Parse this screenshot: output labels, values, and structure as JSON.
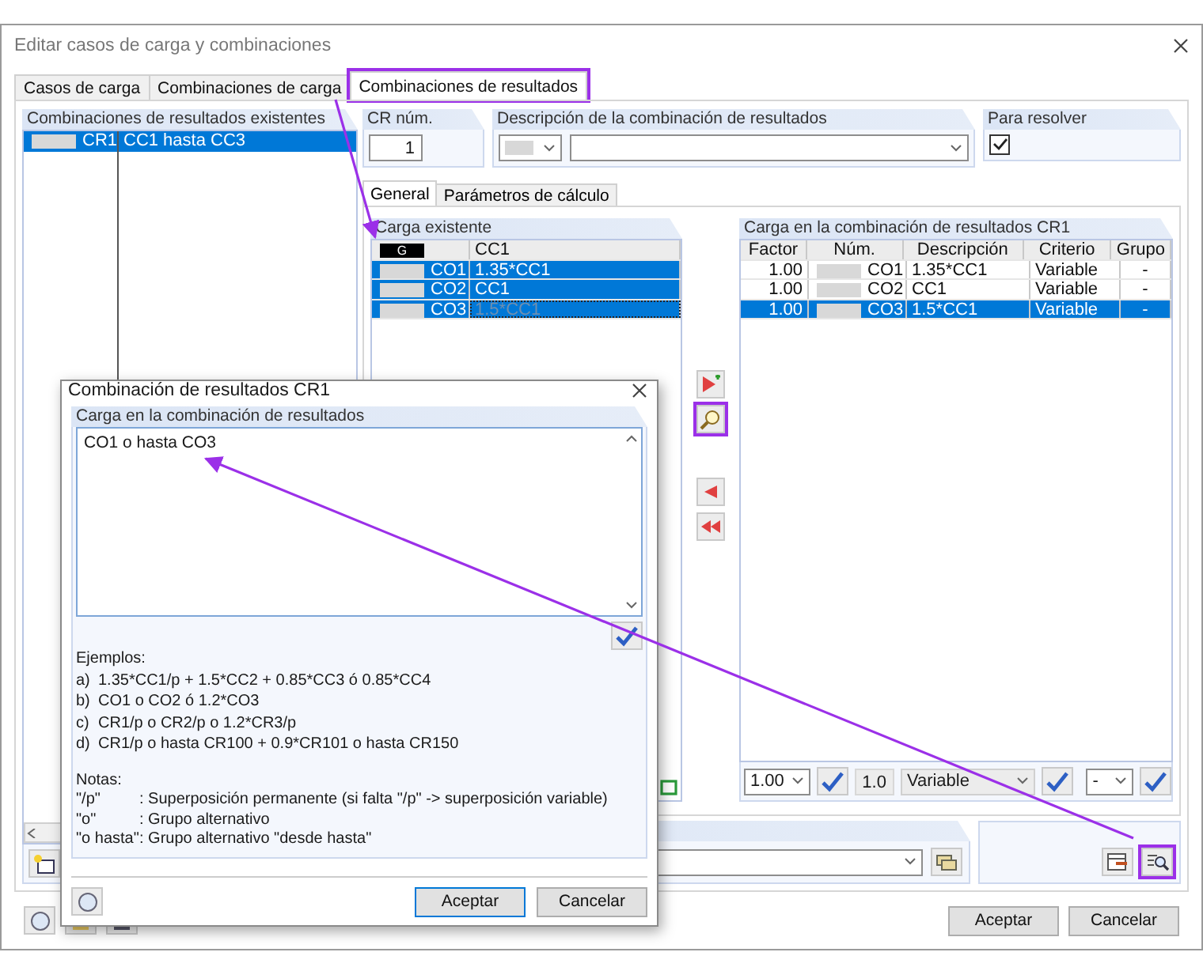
{
  "window": {
    "title": "Editar casos de carga y combinaciones"
  },
  "tabs": [
    {
      "label": "Casos de carga",
      "selected": false,
      "highlighted": false
    },
    {
      "label": "Combinaciones de carga",
      "selected": false,
      "highlighted": false
    },
    {
      "label": "Combinaciones de resultados",
      "selected": true,
      "highlighted": true
    }
  ],
  "existing": {
    "title": "Combinaciones de resultados existentes",
    "rows": [
      {
        "number": "CR1",
        "description": "CC1 hasta CC3",
        "selected": true
      }
    ]
  },
  "cr_number": {
    "label": "CR núm.",
    "value": "1"
  },
  "description": {
    "label": "Descripción de la combinación de resultados"
  },
  "to_solve": {
    "label": "Para resolver",
    "checked": true
  },
  "subtabs": [
    {
      "label": "General",
      "selected": true
    },
    {
      "label": "Parámetros de cálculo",
      "selected": false
    }
  ],
  "existing_loads": {
    "title": "Carga existente",
    "group": {
      "badge": "G",
      "label": "CC1"
    },
    "rows": [
      {
        "number": "CO1",
        "description": "1.35*CC1",
        "selected": true,
        "dimmed": false
      },
      {
        "number": "CO2",
        "description": "CC1",
        "selected": true,
        "dimmed": false
      },
      {
        "number": "CO3",
        "description": "1.5*CC1",
        "selected": true,
        "dimmed": true
      }
    ]
  },
  "transfer_buttons": [
    {
      "kind": "add",
      "highlighted": false
    },
    {
      "kind": "edit",
      "highlighted": true
    },
    {
      "kind": "remove",
      "highlighted": false
    },
    {
      "kind": "remove_all",
      "highlighted": false
    }
  ],
  "combination": {
    "title": "Carga en la combinación de resultados CR1",
    "columns": [
      "Factor",
      "Núm.",
      "Descripción",
      "Criterio",
      "Grupo"
    ],
    "rows": [
      {
        "factor": "1.00",
        "number": "CO1",
        "description": "1.35*CC1",
        "criterion": "Variable",
        "group": "-",
        "selected": false
      },
      {
        "factor": "1.00",
        "number": "CO2",
        "description": "CC1",
        "criterion": "Variable",
        "group": "-",
        "selected": false
      },
      {
        "factor": "1.00",
        "number": "CO3",
        "description": "1.5*CC1",
        "criterion": "Variable",
        "group": "-",
        "selected": true
      }
    ],
    "factor": "1.00",
    "criterion_factor": "1.0",
    "criterion": "Variable",
    "group": "-"
  },
  "tools": [
    {
      "kind": "export",
      "highlighted": false
    },
    {
      "kind": "zoom",
      "highlighted": true
    }
  ],
  "buttons": [
    "Aceptar",
    "Cancelar"
  ],
  "dialog": {
    "title": "Combinación de resultados CR1",
    "field_label": "Carga en la combinación de resultados",
    "value": "CO1 o hasta CO3",
    "examples_title": "Ejemplos:",
    "examples": [
      {
        "marker": "a)",
        "text": "1.35*CC1/p + 1.5*CC2 + 0.85*CC3 ó 0.85*CC4"
      },
      {
        "marker": "b)",
        "text": "CO1 o CO2 ó 1.2*CO3"
      },
      {
        "marker": "c)",
        "text": "CR1/p o CR2/p o 1.2*CR3/p"
      },
      {
        "marker": "d)",
        "text": "CR1/p o hasta CR100 + 0.9*CR101 o hasta CR150"
      }
    ],
    "notes_title": "Notas:",
    "notes": [
      {
        "term": "\"/p\"",
        "text": ": Superposición permanente (si falta \"/p\" -> superposición variable)"
      },
      {
        "term": "\"o\"",
        "text": ": Grupo alternativo"
      },
      {
        "term": "\"o hasta\"",
        "text": ": Grupo alternativo \"desde hasta\""
      }
    ],
    "buttons": [
      "Aceptar",
      "Cancelar"
    ]
  }
}
